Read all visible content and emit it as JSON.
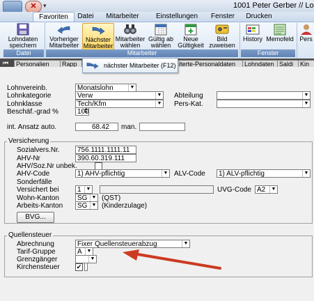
{
  "window": {
    "title": "1001 Peter Gerber // Lo"
  },
  "ribbon": {
    "tabs": [
      "Favoriten",
      "Datei",
      "Mitarbeiter",
      "Einstellungen",
      "Fenster",
      "Drucken"
    ],
    "buttons": {
      "lohndaten": "Lohndaten speichern",
      "vorheriger": "Vorheriger Mitarbeiter",
      "naechster": "Nächster Mitarbeiter",
      "waehlen": "Mitarbeiter wählen",
      "gueltig": "Gültig ab wählen",
      "neue": "Neue Gültigkeit",
      "bild": "Bild zuweisen",
      "history": "History",
      "memofeld": "Memofeld",
      "pers": "Pers"
    },
    "groups": {
      "datei": "Datei",
      "mitarbeiter": "Mitarbeiter",
      "fenster": "Fenster"
    }
  },
  "doc_tabs": [
    "Personalien",
    "Rapp",
    "iterte-Personaldaten",
    "Lohndaten",
    "Saldi",
    "Kin"
  ],
  "tooltip": {
    "text": "nächster Mitarbeiter (F12)"
  },
  "form": {
    "lohnvereinb_label": "Lohnvereinb.",
    "lohnvereinb_value": "Monatslohn",
    "lohnkategorie_label": "Lohnkategorie",
    "lohnkategorie_value": "Verw",
    "lohnklasse_label": "Lohnklasse",
    "lohnklasse_value": "Tech/Kfm",
    "beschaef_label": "Beschäf.-grad %",
    "beschaef_value": "100",
    "abteilung_label": "Abteilung",
    "perskat_label": "Pers-Kat.",
    "ansatz_label": "int. Ansatz auto.",
    "ansatz_value": "68.42",
    "man_label": "man."
  },
  "versicherung": {
    "title": "Versicherung",
    "sozial_label": "Sozialvers.Nr.",
    "sozial_value": "756.1111.1111.11",
    "ahv_label": "AHV-Nr",
    "ahv_value": "390.60.319.111",
    "unbek_label": "AHV/Soz.Nr unbek.",
    "ahvcode_label": "AHV-Code",
    "ahvcode_value": "1) AHV-pflichtig",
    "alvcode_label": "ALV-Code",
    "alvcode_value": "1) ALV-pflichtig",
    "sonder_label": "Sonderfälle",
    "versbei_label": "Versichert bei",
    "versbei_value": "1",
    "uvg_label": "UVG-Code",
    "uvg_value": "A2",
    "wohn_label": "Wohn-Kanton",
    "wohn_value": "SG",
    "wohn_note": "(QST)",
    "arbeit_label": "Arbeits-Kanton",
    "arbeit_value": "SG",
    "arbeit_note": "(Kinderzulage)",
    "bvg_button": "BVG..."
  },
  "quellensteuer": {
    "title": "Quellensteuer",
    "abrechnung_label": "Abrechnung",
    "abrechnung_value": "Fixer Quellensteuerabzug",
    "tarif_label": "Tarif-Gruppe",
    "tarif_value": "A",
    "grenz_label": "Grenzgänger",
    "kirchen_label": "Kirchensteuer",
    "kirchen_check": "✔"
  },
  "colors": {
    "accent": "#cc3a22",
    "ribbon_group": "#6b8cbc",
    "highlight": "#ffd55f"
  }
}
